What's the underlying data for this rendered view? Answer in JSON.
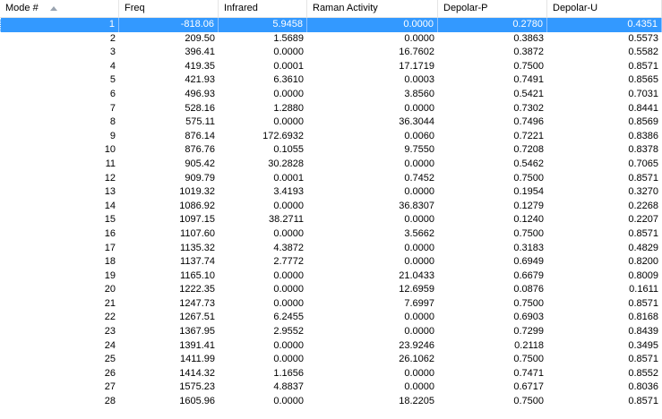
{
  "columns": [
    "Mode #",
    "Freq",
    "Infrared",
    "Raman Activity",
    "Depolar-P",
    "Depolar-U"
  ],
  "sort": {
    "column": "Mode #",
    "direction": "ascending"
  },
  "selected_row": 0,
  "colors": {
    "selection": "#3399ff",
    "selection_text": "#ffffff",
    "header_divider": "#e5e5e5"
  },
  "rows": [
    [
      "1",
      "-818.06",
      "5.9458",
      "0.0000",
      "0.2780",
      "0.4351"
    ],
    [
      "2",
      "209.50",
      "1.5689",
      "0.0000",
      "0.3863",
      "0.5573"
    ],
    [
      "3",
      "396.41",
      "0.0000",
      "16.7602",
      "0.3872",
      "0.5582"
    ],
    [
      "4",
      "419.35",
      "0.0001",
      "17.1719",
      "0.7500",
      "0.8571"
    ],
    [
      "5",
      "421.93",
      "6.3610",
      "0.0003",
      "0.7491",
      "0.8565"
    ],
    [
      "6",
      "496.93",
      "0.0000",
      "3.8560",
      "0.5421",
      "0.7031"
    ],
    [
      "7",
      "528.16",
      "1.2880",
      "0.0000",
      "0.7302",
      "0.8441"
    ],
    [
      "8",
      "575.11",
      "0.0000",
      "36.3044",
      "0.7496",
      "0.8569"
    ],
    [
      "9",
      "876.14",
      "172.6932",
      "0.0060",
      "0.7221",
      "0.8386"
    ],
    [
      "10",
      "876.76",
      "0.1055",
      "9.7550",
      "0.7208",
      "0.8378"
    ],
    [
      "11",
      "905.42",
      "30.2828",
      "0.0000",
      "0.5462",
      "0.7065"
    ],
    [
      "12",
      "909.79",
      "0.0001",
      "0.7452",
      "0.7500",
      "0.8571"
    ],
    [
      "13",
      "1019.32",
      "3.4193",
      "0.0000",
      "0.1954",
      "0.3270"
    ],
    [
      "14",
      "1086.92",
      "0.0000",
      "36.8307",
      "0.1279",
      "0.2268"
    ],
    [
      "15",
      "1097.15",
      "38.2711",
      "0.0000",
      "0.1240",
      "0.2207"
    ],
    [
      "16",
      "1107.60",
      "0.0000",
      "3.5662",
      "0.7500",
      "0.8571"
    ],
    [
      "17",
      "1135.32",
      "4.3872",
      "0.0000",
      "0.3183",
      "0.4829"
    ],
    [
      "18",
      "1137.74",
      "2.7772",
      "0.0000",
      "0.6949",
      "0.8200"
    ],
    [
      "19",
      "1165.10",
      "0.0000",
      "21.0433",
      "0.6679",
      "0.8009"
    ],
    [
      "20",
      "1222.35",
      "0.0000",
      "12.6959",
      "0.0876",
      "0.1611"
    ],
    [
      "21",
      "1247.73",
      "0.0000",
      "7.6997",
      "0.7500",
      "0.8571"
    ],
    [
      "22",
      "1267.51",
      "6.2455",
      "0.0000",
      "0.6903",
      "0.8168"
    ],
    [
      "23",
      "1367.95",
      "2.9552",
      "0.0000",
      "0.7299",
      "0.8439"
    ],
    [
      "24",
      "1391.41",
      "0.0000",
      "23.9246",
      "0.2118",
      "0.3495"
    ],
    [
      "25",
      "1411.99",
      "0.0000",
      "26.1062",
      "0.7500",
      "0.8571"
    ],
    [
      "26",
      "1414.32",
      "1.1656",
      "0.0000",
      "0.7471",
      "0.8552"
    ],
    [
      "27",
      "1575.23",
      "4.8837",
      "0.0000",
      "0.6717",
      "0.8036"
    ],
    [
      "28",
      "1605.96",
      "0.0000",
      "18.2205",
      "0.7500",
      "0.8571"
    ]
  ]
}
